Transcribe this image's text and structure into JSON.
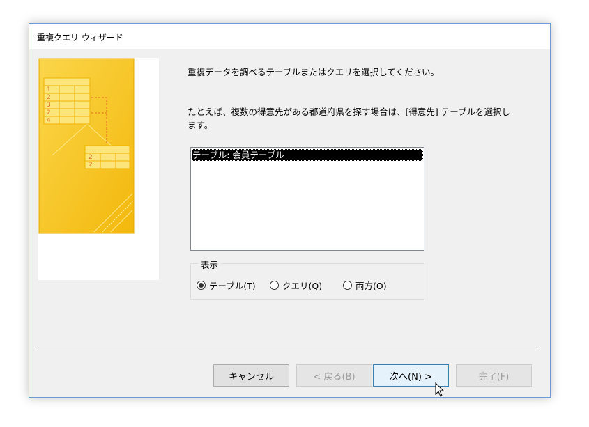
{
  "window": {
    "title": "重複クエリ ウィザード"
  },
  "instruction": "重複データを調べるテーブルまたはクエリを選択してください。",
  "example_line1": "たとえば、複数の得意先がある都道府県を探す場合は、[得意先] テーブルを選択し",
  "example_line2": "ます。",
  "list": {
    "items": [
      "テーブル: 会員テーブル"
    ],
    "selected_index": 0
  },
  "view_group": {
    "label": "表示",
    "options": [
      {
        "label": "テーブル(T)",
        "selected": true
      },
      {
        "label": "クエリ(Q)",
        "selected": false
      },
      {
        "label": "両方(O)",
        "selected": false
      }
    ]
  },
  "buttons": {
    "cancel": "キャンセル",
    "back": "< 戻る(B)",
    "next": "次へ(N) >",
    "finish": "完了(F)"
  },
  "art": {
    "table1_numbers": [
      "1",
      "2",
      "3",
      "2",
      "4"
    ],
    "table2_numbers": [
      "2",
      "2"
    ]
  },
  "colors": {
    "accent": "#6f9ad6",
    "art_gold": "#f7c51e"
  }
}
